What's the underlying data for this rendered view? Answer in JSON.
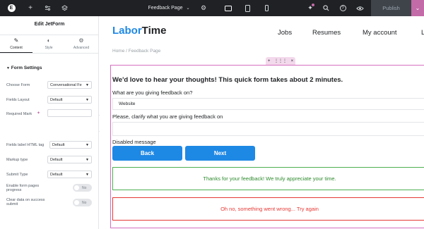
{
  "topbar": {
    "page_title": "Feedback Page",
    "publish_label": "Publish",
    "icons": [
      "elementor-logo-icon",
      "plus-icon",
      "sliders-icon",
      "layers-icon",
      "chevron-down-icon",
      "gear-icon",
      "desktop-icon",
      "tablet-icon",
      "mobile-icon",
      "notifications-icon",
      "search-icon",
      "help-icon",
      "eye-icon"
    ]
  },
  "panel": {
    "title": "Edit JetForm",
    "tabs": [
      {
        "label": "Content",
        "icon": "pencil-icon"
      },
      {
        "label": "Style",
        "icon": "half-circle-icon"
      },
      {
        "label": "Advanced",
        "icon": "gear-icon"
      }
    ],
    "section_title": "Form Settings",
    "choose_form": {
      "label": "Choose Form",
      "value": "Conversational Fe"
    },
    "fields_layout": {
      "label": "Fields Layout",
      "value": "Default"
    },
    "required_mark": {
      "label": "Required Mark",
      "value": ""
    },
    "fields_label_tag": {
      "label": "Fields label HTML tag",
      "value": "Default"
    },
    "markup_type": {
      "label": "Markup type",
      "value": "Default"
    },
    "submit_type": {
      "label": "Submit Type",
      "value": "Default"
    },
    "enable_progress": {
      "label": "Enable form pages progress",
      "toggle": "No"
    },
    "clear_data": {
      "label": "Clear data on success submit",
      "toggle": "No"
    }
  },
  "site": {
    "brand_part1": "Labor",
    "brand_part2": "Time",
    "nav": [
      "Jobs",
      "Resumes",
      "My account",
      "L"
    ],
    "breadcrumb": "Home / Feedback Page"
  },
  "form": {
    "title": "We'd love to hear your thoughts! This quick form takes about 2 minutes.",
    "q1_label": "What are you giving feedback on?",
    "q1_value": "Website",
    "q2_label": "Please, clarify what you are giving feedback on",
    "q2_value": "",
    "disabled_message": "Disabled message",
    "back_label": "Back",
    "next_label": "Next",
    "success_message": "Thanks for your feedback! We truly appreciate your time.",
    "error_message": "Oh no, something went wrong... Try again"
  },
  "colors": {
    "accent_blue": "#1e88e5",
    "elementor_pink": "#c36aa8",
    "topbar_dark": "#1f2124",
    "success_green": "#4caf50",
    "error_red": "#e53935"
  }
}
